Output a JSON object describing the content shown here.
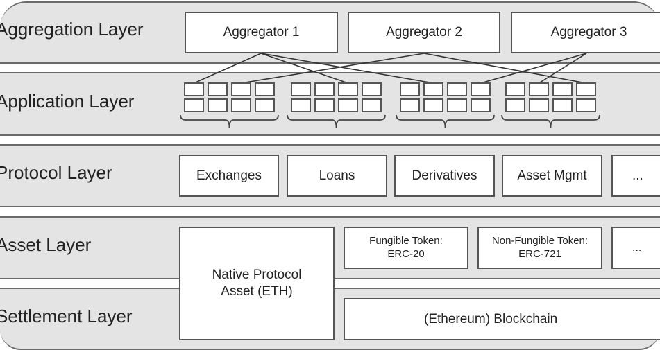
{
  "layers": {
    "aggregation": "Aggregation Layer",
    "application": "Application Layer",
    "protocol": "Protocol Layer",
    "asset": "Asset Layer",
    "settlement": "Settlement Layer"
  },
  "aggregators": [
    "Aggregator 1",
    "Aggregator 2",
    "Aggregator 3"
  ],
  "application_groups": {
    "count": 4,
    "rows": 2,
    "cols": 4
  },
  "connections": [
    {
      "from": 0,
      "group": 0,
      "cell": 0
    },
    {
      "from": 0,
      "group": 1,
      "cell": 2
    },
    {
      "from": 0,
      "group": 2,
      "cell": 1
    },
    {
      "from": 1,
      "group": 0,
      "cell": 2
    },
    {
      "from": 1,
      "group": 3,
      "cell": 3
    },
    {
      "from": 2,
      "group": 2,
      "cell": 3
    },
    {
      "from": 2,
      "group": 3,
      "cell": 1
    }
  ],
  "protocols": [
    "Exchanges",
    "Loans",
    "Derivatives",
    "Asset Mgmt",
    "..."
  ],
  "assets": {
    "native": [
      "Native Protocol",
      "Asset (ETH)"
    ],
    "fungible": [
      "Fungible Token:",
      "ERC-20"
    ],
    "non_fungible": [
      "Non-Fungible Token:",
      "ERC-721"
    ],
    "more": "..."
  },
  "settlement": {
    "blockchain": "(Ethereum) Blockchain"
  }
}
